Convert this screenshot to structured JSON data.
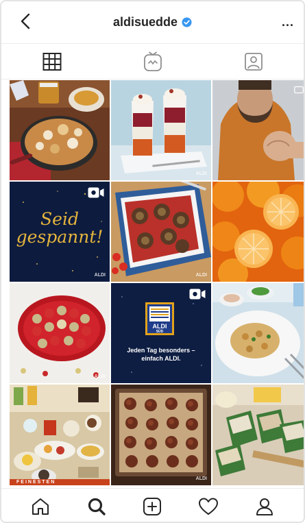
{
  "header": {
    "username": "aldisuedde",
    "back_icon": "chevron-left-icon",
    "verified_icon": "verified-badge-icon",
    "more_label": "..."
  },
  "tabs": [
    {
      "icon": "grid-icon",
      "active": true
    },
    {
      "icon": "igtv-icon",
      "active": false
    },
    {
      "icon": "tagged-icon",
      "active": false
    }
  ],
  "posts": {
    "seid": {
      "text": "Seid gespannt!"
    },
    "aldi_logo": {
      "line1": "ALDI",
      "line2": "SÜD"
    },
    "aldi_caption": {
      "line1": "Jeden Tag besonders –",
      "line2": "einfach ALDI."
    },
    "foot_strip": "FEINESTEN"
  },
  "nav": [
    {
      "icon": "home-icon"
    },
    {
      "icon": "search-icon"
    },
    {
      "icon": "new-post-icon"
    },
    {
      "icon": "activity-heart-icon"
    },
    {
      "icon": "profile-icon"
    }
  ],
  "colors": {
    "verified_blue": "#3897f0",
    "text": "#262626",
    "gold": "#e5b53d",
    "aldi_blue": "#1f3d8a"
  }
}
